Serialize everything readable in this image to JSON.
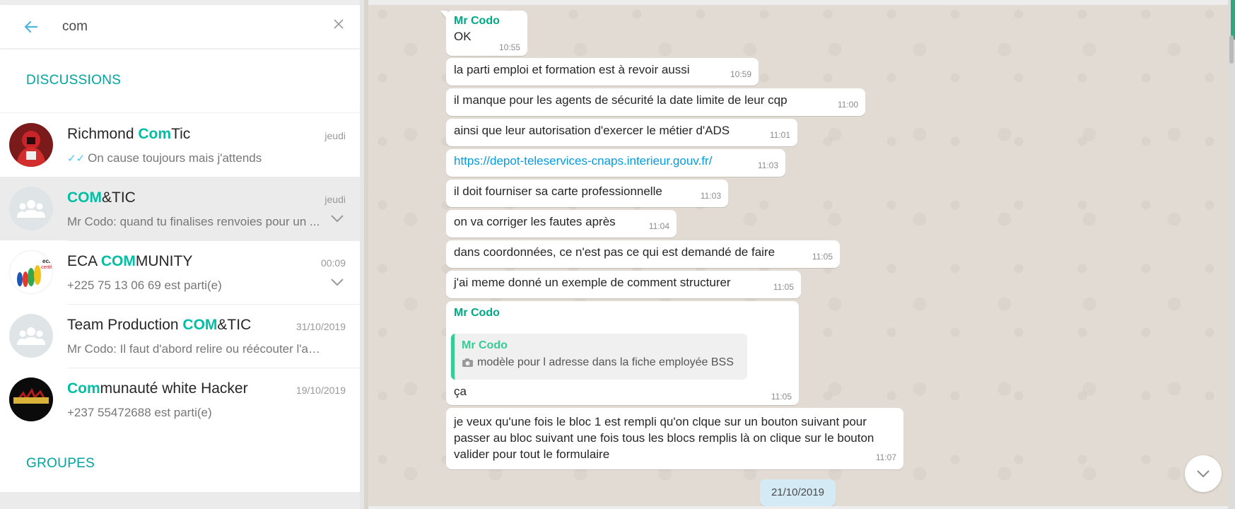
{
  "search": {
    "value": "com"
  },
  "sections": {
    "discussions": "DISCUSSIONS",
    "groups": "GROUPES"
  },
  "chats": [
    {
      "name_pre": "Richmond ",
      "name_hl": "Com",
      "name_post": "Tic",
      "time": "jeudi",
      "preview": "On cause toujours mais j'attends",
      "ticks": true,
      "avatar": "red-hooded-avatar"
    },
    {
      "name_pre": "",
      "name_hl": "COM",
      "name_post": "&TIC",
      "time": "jeudi",
      "preview": "Mr Codo: quand tu finalises renvoies pour un ...",
      "avatar": "group-avatar",
      "active": true
    },
    {
      "name_pre": "ECA ",
      "name_hl": "COM",
      "name_post": "MUNITY",
      "time": "00:09",
      "preview": "+225 75 13 06 69 est parti(e)",
      "avatar": "eca-certif-logo"
    },
    {
      "name_pre": "Team Production ",
      "name_hl": "COM",
      "name_post": "&TIC",
      "time": "31/10/2019",
      "preview": "Mr Codo: Il faut d'abord relire ou réécouter l'audi...",
      "avatar": "group-avatar"
    },
    {
      "name_pre": "",
      "name_hl": "Com",
      "name_post": "munauté white  Hacker",
      "time": "19/10/2019",
      "preview": "+237 55472688 est parti(e)",
      "avatar": "ithacking-logo"
    }
  ],
  "messages": [
    {
      "sender": "Mr Codo",
      "text": "OK",
      "time": "10:55"
    },
    {
      "text": "la parti emploi et formation est à revoir aussi",
      "time": "10:59"
    },
    {
      "text": "il manque pour les agents  de  sécurité la date limite de leur cqp",
      "time": "11:00"
    },
    {
      "text": "ainsi que leur autorisation d'exercer le métier d'ADS",
      "time": "11:01"
    },
    {
      "link": "https://depot-teleservices-cnaps.interieur.gouv.fr/",
      "time": "11:03"
    },
    {
      "text": "il doit fourniser sa carte professionnelle",
      "time": "11:03"
    },
    {
      "text": "on va corriger les fautes après",
      "time": "11:04"
    },
    {
      "text": "dans coordonnées, ce n'est pas ce qui est demandé de faire",
      "time": "11:05"
    },
    {
      "text": "j'ai meme donné un exemple de comment structurer",
      "time": "11:05"
    },
    {
      "sender": "Mr Codo",
      "quote_sender": "Mr Codo",
      "quote_text": "modèle pour l adresse dans la fiche employée BSS",
      "text": "ça",
      "time": "11:05"
    },
    {
      "text_lines": [
        "je veux qu'une fois le bloc 1 est rempli qu'on clque sur un bouton suivant pour",
        "passer au bloc suivant une fois tous les  blocs  remplis là on clique sur le bouton",
        "valider pour  tout  le formulaire"
      ],
      "time": "11:07"
    }
  ],
  "date_badge": "21/10/2019",
  "colors": {
    "accent": "#00a5a0",
    "highlight": "#00bfa5",
    "link": "#039be5",
    "sender": "#00a884"
  }
}
